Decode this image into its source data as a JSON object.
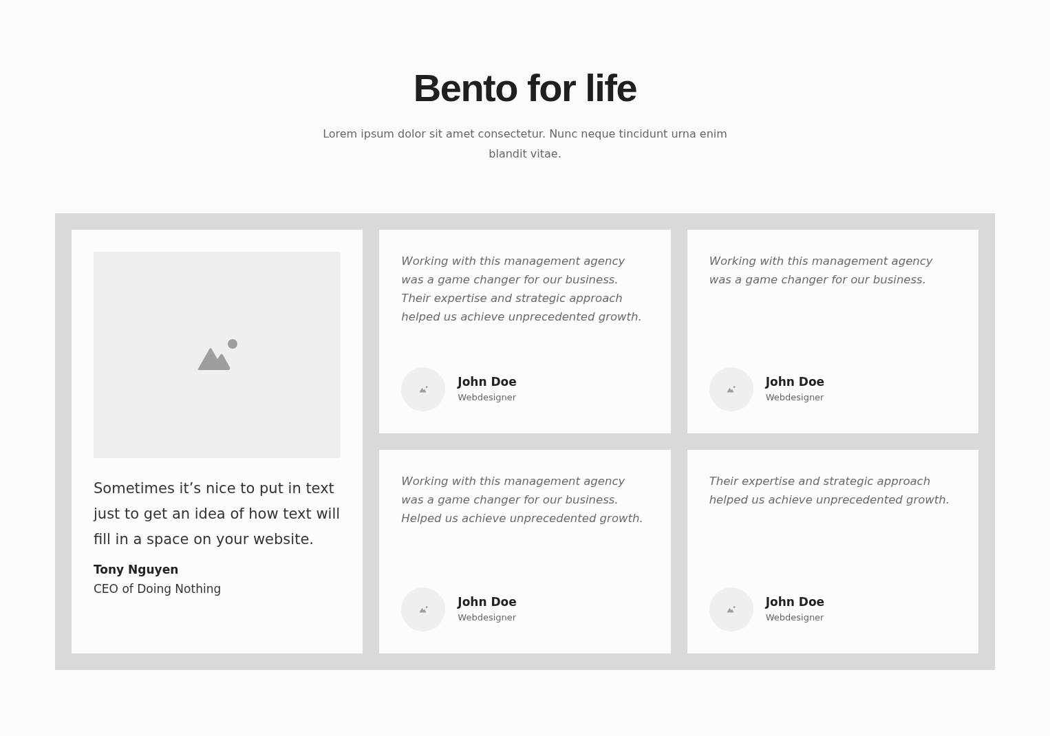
{
  "header": {
    "title": "Bento for life",
    "subtitle": "Lorem ipsum dolor sit amet consectetur. Nunc neque tincidunt urna enim blandit vitae."
  },
  "feature": {
    "quote": "Sometimes it’s nice to put in text just to get an idea of how text will fill in a space on your website.",
    "name": "Tony Nguyen",
    "role": "CEO of Doing Nothing"
  },
  "testimonials": [
    {
      "quote": "Working with this management agency was a game changer for our business. Their expertise and strategic approach helped us achieve unprecedented growth.",
      "name": "John Doe",
      "role": "Webdesigner"
    },
    {
      "quote": "Working with this management agency was a game changer for our business.",
      "name": "John Doe",
      "role": "Webdesigner"
    },
    {
      "quote": "Working with this management agency was a game changer for our business. Helped us achieve unprecedented growth.",
      "name": "John Doe",
      "role": "Webdesigner"
    },
    {
      "quote": "Their expertise and strategic approach helped us achieve unprecedented growth.",
      "name": "John Doe",
      "role": "Webdesigner"
    }
  ]
}
